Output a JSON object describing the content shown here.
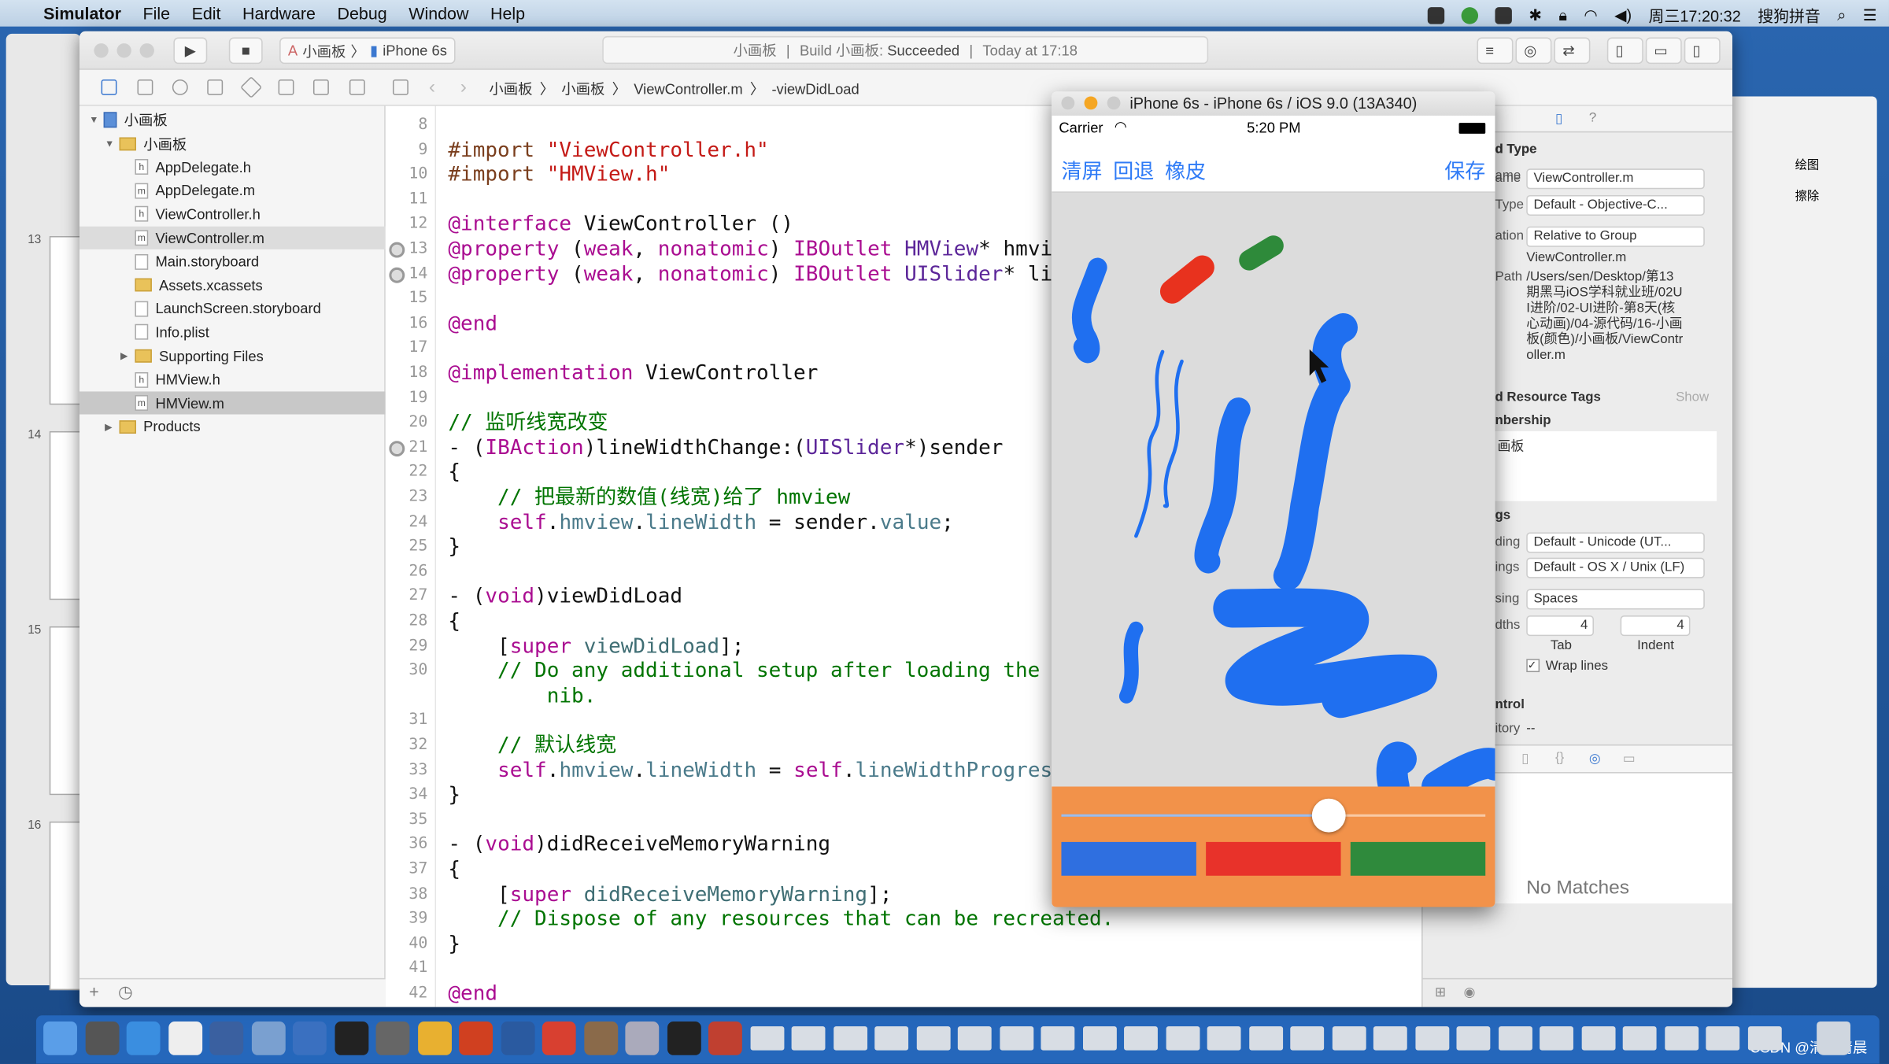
{
  "menubar": {
    "app": "Simulator",
    "items": [
      "File",
      "Edit",
      "Hardware",
      "Debug",
      "Window",
      "Help"
    ],
    "clock": "周三17:20:32",
    "input_method": "搜狗拼音"
  },
  "background_window": {
    "slides": [
      "13",
      "14",
      "15",
      "16"
    ]
  },
  "toolbar": {
    "scheme": "小画板",
    "device": "iPhone 6s",
    "activity": {
      "project": "小画板",
      "build": "Build 小画板:",
      "result": "Succeeded",
      "time": "Today at 17:18"
    }
  },
  "jumpbar": [
    "小画板",
    "小画板",
    "ViewController.m",
    "-viewDidLoad"
  ],
  "navigator": {
    "items": [
      {
        "label": "小画板",
        "kind": "proj",
        "depth": 0,
        "open": true
      },
      {
        "label": "小画板",
        "kind": "folder",
        "depth": 1,
        "open": true
      },
      {
        "label": "AppDelegate.h",
        "kind": "h",
        "depth": 2
      },
      {
        "label": "AppDelegate.m",
        "kind": "m",
        "depth": 2
      },
      {
        "label": "ViewController.h",
        "kind": "h",
        "depth": 2
      },
      {
        "label": "ViewController.m",
        "kind": "m",
        "depth": 2,
        "selected": "light"
      },
      {
        "label": "Main.storyboard",
        "kind": "sb",
        "depth": 2
      },
      {
        "label": "Assets.xcassets",
        "kind": "folder",
        "depth": 2
      },
      {
        "label": "LaunchScreen.storyboard",
        "kind": "sb",
        "depth": 2
      },
      {
        "label": "Info.plist",
        "kind": "pl",
        "depth": 2
      },
      {
        "label": "Supporting Files",
        "kind": "folder",
        "depth": 2,
        "closed": true
      },
      {
        "label": "HMView.h",
        "kind": "h",
        "depth": 2
      },
      {
        "label": "HMView.m",
        "kind": "m",
        "depth": 2,
        "selected": "dark"
      },
      {
        "label": "Products",
        "kind": "folder",
        "depth": 1,
        "closed": true
      }
    ]
  },
  "code": [
    {
      "n": "8",
      "t": []
    },
    {
      "n": "9",
      "t": [
        [
          "#import ",
          "pp"
        ],
        [
          "\"ViewController.h\"",
          "str"
        ]
      ]
    },
    {
      "n": "10",
      "t": [
        [
          "#import ",
          "pp"
        ],
        [
          "\"HMView.h\"",
          "str"
        ]
      ]
    },
    {
      "n": "11",
      "t": []
    },
    {
      "n": "12",
      "t": [
        [
          "@interface ",
          "kw"
        ],
        [
          "ViewController ()",
          ""
        ]
      ]
    },
    {
      "n": "13",
      "bp": true,
      "t": [
        [
          "@property ",
          "kw"
        ],
        [
          "(",
          ""
        ],
        [
          "weak",
          "kw"
        ],
        [
          ", ",
          ""
        ],
        [
          "nonatomic",
          "kw"
        ],
        [
          ") ",
          ""
        ],
        [
          "IBOutlet ",
          "kw"
        ],
        [
          "HMView",
          "cls"
        ],
        [
          "* hmview;",
          ""
        ]
      ]
    },
    {
      "n": "14",
      "bp": true,
      "t": [
        [
          "@property ",
          "kw"
        ],
        [
          "(",
          ""
        ],
        [
          "weak",
          "kw"
        ],
        [
          ", ",
          ""
        ],
        [
          "nonatomic",
          "kw"
        ],
        [
          ") ",
          ""
        ],
        [
          "IBOutlet ",
          "kw"
        ],
        [
          "UISlider",
          "cls"
        ],
        [
          "* lineWidthProgress;",
          ""
        ]
      ]
    },
    {
      "n": "15",
      "t": []
    },
    {
      "n": "16",
      "t": [
        [
          "@end",
          "kw"
        ]
      ]
    },
    {
      "n": "17",
      "t": []
    },
    {
      "n": "18",
      "t": [
        [
          "@implementation ",
          "kw"
        ],
        [
          "ViewController",
          ""
        ]
      ]
    },
    {
      "n": "19",
      "t": []
    },
    {
      "n": "20",
      "t": [
        [
          "// 监听线宽改变",
          "cm"
        ]
      ]
    },
    {
      "n": "21",
      "bp": true,
      "t": [
        [
          "- (",
          ""
        ],
        [
          "IBAction",
          "kw"
        ],
        [
          ")lineWidthChange:(",
          ""
        ],
        [
          "UISlider",
          "cls"
        ],
        [
          "*)sender",
          ""
        ]
      ]
    },
    {
      "n": "22",
      "t": [
        [
          "{",
          ""
        ]
      ]
    },
    {
      "n": "23",
      "t": [
        [
          "    // 把最新的数值(线宽)给了 hmview",
          "cm"
        ]
      ]
    },
    {
      "n": "24",
      "t": [
        [
          "    ",
          ""
        ],
        [
          "self",
          "kw"
        ],
        [
          ".",
          ""
        ],
        [
          "hmview",
          "pr"
        ],
        [
          ".",
          ""
        ],
        [
          "lineWidth",
          "pr"
        ],
        [
          " = sender.",
          ""
        ],
        [
          "value",
          "pr"
        ],
        [
          ";",
          ""
        ]
      ]
    },
    {
      "n": "25",
      "t": [
        [
          "}",
          ""
        ]
      ]
    },
    {
      "n": "26",
      "t": []
    },
    {
      "n": "27",
      "t": [
        [
          "- (",
          ""
        ],
        [
          "void",
          "kw"
        ],
        [
          ")viewDidLoad",
          ""
        ]
      ]
    },
    {
      "n": "28",
      "t": [
        [
          "{",
          ""
        ]
      ]
    },
    {
      "n": "29",
      "t": [
        [
          "    [",
          ""
        ],
        [
          "super",
          "kw"
        ],
        [
          " ",
          ""
        ],
        [
          "viewDidLoad",
          "ty"
        ],
        [
          "];",
          ""
        ]
      ]
    },
    {
      "n": "30",
      "t": [
        [
          "    // Do any additional setup after loading the view, typically from a",
          "cm"
        ]
      ]
    },
    {
      "n": "",
      "t": [
        [
          "        nib.",
          "cm"
        ]
      ]
    },
    {
      "n": "31",
      "t": []
    },
    {
      "n": "32",
      "t": [
        [
          "    // 默认线宽",
          "cm"
        ]
      ]
    },
    {
      "n": "33",
      "t": [
        [
          "    ",
          ""
        ],
        [
          "self",
          "kw"
        ],
        [
          ".",
          ""
        ],
        [
          "hmview",
          "pr"
        ],
        [
          ".",
          ""
        ],
        [
          "lineWidth",
          "pr"
        ],
        [
          " = ",
          ""
        ],
        [
          "self",
          "kw"
        ],
        [
          ".",
          ""
        ],
        [
          "lineWidthProgress",
          "pr"
        ],
        [
          ".",
          ""
        ],
        [
          "value",
          "pr"
        ],
        [
          ";",
          ""
        ]
      ]
    },
    {
      "n": "34",
      "t": [
        [
          "}",
          ""
        ]
      ]
    },
    {
      "n": "35",
      "t": []
    },
    {
      "n": "36",
      "t": [
        [
          "- (",
          ""
        ],
        [
          "void",
          "kw"
        ],
        [
          ")didReceiveMemoryWarning",
          ""
        ]
      ]
    },
    {
      "n": "37",
      "t": [
        [
          "{",
          ""
        ]
      ]
    },
    {
      "n": "38",
      "t": [
        [
          "    [",
          ""
        ],
        [
          "super",
          "kw"
        ],
        [
          " ",
          ""
        ],
        [
          "didReceiveMemoryWarning",
          "ty"
        ],
        [
          "];",
          ""
        ]
      ]
    },
    {
      "n": "39",
      "t": [
        [
          "    // Dispose of any resources that can be recreated.",
          "cm"
        ]
      ]
    },
    {
      "n": "40",
      "t": [
        [
          "}",
          ""
        ]
      ]
    },
    {
      "n": "41",
      "t": []
    },
    {
      "n": "42",
      "t": [
        [
          "@end",
          "kw"
        ]
      ]
    }
  ],
  "inspector": {
    "identity_header": "d Type",
    "name_label": "ame",
    "name_value": "ViewController.m",
    "type_label": "Type",
    "type_value": "Default - Objective-C...",
    "location_label": "ation",
    "location_value": "Relative to Group",
    "filename": "ViewController.m",
    "path_label": "Path",
    "path_value": "/Users/sen/Desktop/第13期黑马iOS学科就业班/02UI进阶/02-UI进阶-第8天(核心动画)/04-源代码/16-小画板(颜色)/小画板/ViewController.m",
    "tags_header": "d Resource Tags",
    "tags_show": "Show",
    "membership_header": "nbership",
    "membership_item": "画板",
    "settings_header": "gs",
    "encoding_label": "ding",
    "encoding_value": "Default - Unicode (UT...",
    "endings_label": "ings",
    "endings_value": "Default - OS X / Unix (LF)",
    "indent_using_label": "sing",
    "indent_using_value": "Spaces",
    "widths_label": "dths",
    "tab_value": "4",
    "indent_value": "4",
    "tab_label": "Tab",
    "indent_label": "Indent",
    "wrap_label": "Wrap lines",
    "wrap_checked": true,
    "sc_header": "ntrol",
    "repo_label": "itory",
    "repo_value": "--",
    "library_empty": "No Matches"
  },
  "simulator": {
    "title": "iPhone 6s - iPhone 6s / iOS 9.0 (13A340)",
    "carrier": "Carrier",
    "time": "5:20 PM",
    "nav_buttons": [
      "清屏",
      "回退",
      "橡皮"
    ],
    "save": "保存",
    "slider_value": 0.63,
    "color_buttons": [
      "#2f6fe0",
      "#e8322a",
      "#2f8a3c"
    ],
    "colors": {
      "stroke_blue": "#1f6ff0",
      "stroke_red": "#e8321e",
      "stroke_green": "#2e8a3a",
      "panel": "#f2924a",
      "canvas": "#dcdcdc"
    }
  },
  "right_window": {
    "draw": "绘图",
    "erase": "擦除"
  },
  "watermark": "CSDN @清风清晨"
}
